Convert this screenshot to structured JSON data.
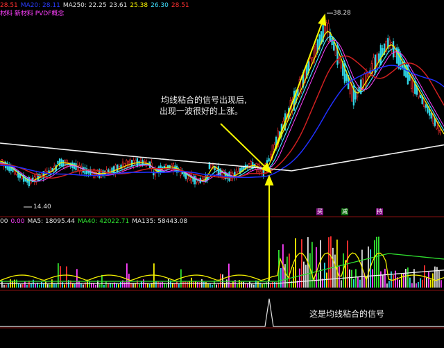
{
  "colors": {
    "bg": "#000000",
    "ma_white": "#f0f0f0",
    "ma_yellow": "#f4f000",
    "ma_cyan": "#40e0ff",
    "ma_magenta": "#ff40ff",
    "ma_red": "#d02020",
    "ma_blue": "#2030ff",
    "up_candle": "#ff3030",
    "down_candle": "#30d8e8",
    "arrow": "#f8f800",
    "signal_line": "#e0e0e0"
  },
  "price_panel": {
    "ma_line": [
      {
        "label": "",
        "value": "28.51",
        "color": "#ff3030"
      },
      {
        "label": "MA20: ",
        "value": "28.11",
        "color": "#2a3cff"
      },
      {
        "label": "MA250: ",
        "value": "22.25",
        "color": "#e0e0e0"
      },
      {
        "label": "",
        "value": "23.61",
        "color": "#e0e0e0"
      },
      {
        "label": "",
        "value": "25.38",
        "color": "#f4f000"
      },
      {
        "label": "",
        "value": "26.30",
        "color": "#40e0ff"
      },
      {
        "label": "",
        "value": "28.51",
        "color": "#ff3030"
      }
    ],
    "concepts": "材料 新材料 PVDF概念",
    "high_label": "38.28",
    "low_label": "14.40",
    "annotation_line1": "均线粘合的信号出现后,",
    "annotation_line2": "出现一波很好的上涨。"
  },
  "volume_panel": {
    "stats": [
      {
        "label": "00",
        "value": "",
        "color": "#e0e0e0"
      },
      {
        "label": "",
        "value": "0.00",
        "color": "#ff40ff"
      },
      {
        "label": "MA5: ",
        "value": "18095.44",
        "color": "#e0e0e0"
      },
      {
        "label": "MA40: ",
        "value": "42022.71",
        "color": "#30e030"
      },
      {
        "label": "MA135: ",
        "value": "58443.08",
        "color": "#e0e0e0"
      }
    ],
    "tags": [
      {
        "text": "买",
        "color": "#ff40ff"
      },
      {
        "text": "减",
        "color": "#30e030"
      },
      {
        "text": "持",
        "color": "#ff40ff"
      }
    ]
  },
  "signal_panel": {
    "label": "这是均线粘合的信号"
  }
}
